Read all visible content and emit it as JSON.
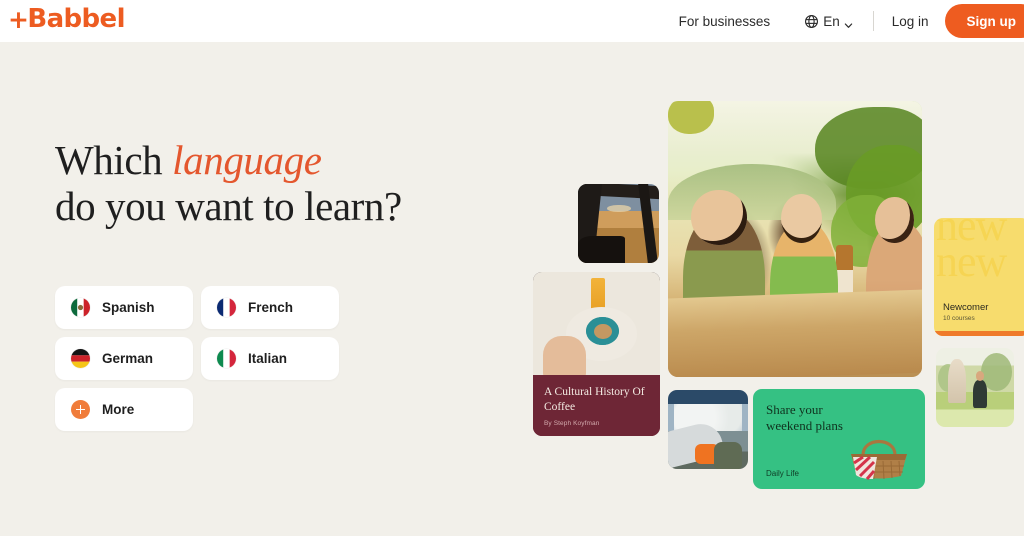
{
  "brand": {
    "logo_plus": "+",
    "logo_text": "Babbel",
    "accent_color": "#ee5c20"
  },
  "header": {
    "for_businesses": "For businesses",
    "globe_icon": "globe-icon",
    "language_code": "En",
    "chevron_icon": "chevron-down-icon",
    "log_in": "Log in",
    "sign_up": "Sign up"
  },
  "hero": {
    "headline_part1": "Which ",
    "headline_accent": "language",
    "headline_part2": "do you want to learn?",
    "languages": [
      {
        "label": "Spanish",
        "flag": "flag-mexico"
      },
      {
        "label": "French",
        "flag": "flag-france"
      },
      {
        "label": "German",
        "flag": "flag-germany"
      },
      {
        "label": "Italian",
        "flag": "flag-italy"
      },
      {
        "label": "More",
        "flag": "plus-circle-icon"
      }
    ]
  },
  "collage": {
    "main_photo_alt": "three-friends-at-outdoor-table-photo",
    "car_photo_alt": "car-window-field-photo",
    "plane_photo_alt": "airplane-wing-clouds-photo",
    "park_photo_alt": "park-umbrella-photo",
    "coffee_card": {
      "title": "A Cultural History Of Coffee",
      "byline": "By Steph Koyfman",
      "background_color": "#6e2636"
    },
    "green_card": {
      "title": "Share your weekend plans",
      "tag": "Daily Life",
      "background_color": "#35c183",
      "illustration": "picnic-basket-icon"
    },
    "yellow_card": {
      "watermark": "new new",
      "title": "Newcomer",
      "subtitle": "10 courses",
      "background_color": "#f7dc6d",
      "strip_color": "#ef7a2a"
    }
  }
}
